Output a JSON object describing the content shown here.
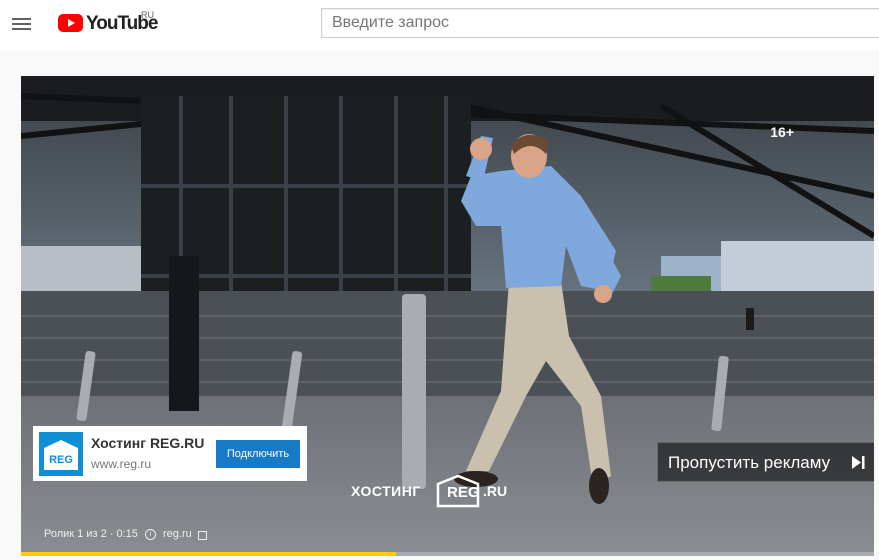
{
  "header": {
    "logo_text": "YouTube",
    "logo_country": "RU",
    "search_placeholder": "Введите запрос"
  },
  "player": {
    "age_rating": "16+",
    "ad_card": {
      "title": "Хостинг REG.RU",
      "url": "www.reg.ru",
      "icon_text": "REG",
      "button_label": "Подключить"
    },
    "skip_button": {
      "label": "Пропустить рекламу",
      "icon": "skip-next-icon"
    },
    "brand_overlay": {
      "hosting": "ХОСТИНГ",
      "reg": "REG",
      "ru": ".RU"
    },
    "ad_info": {
      "counter": "Ролик 1 из 2 · 0:15",
      "domain": "reg.ru"
    },
    "progress": {
      "played_fraction": 0.44
    }
  },
  "colors": {
    "youtube_red": "#ff0000",
    "ad_button_blue": "#167ac6",
    "reg_blue": "#0f8fd6",
    "ad_progress_yellow": "#ffcc00"
  }
}
